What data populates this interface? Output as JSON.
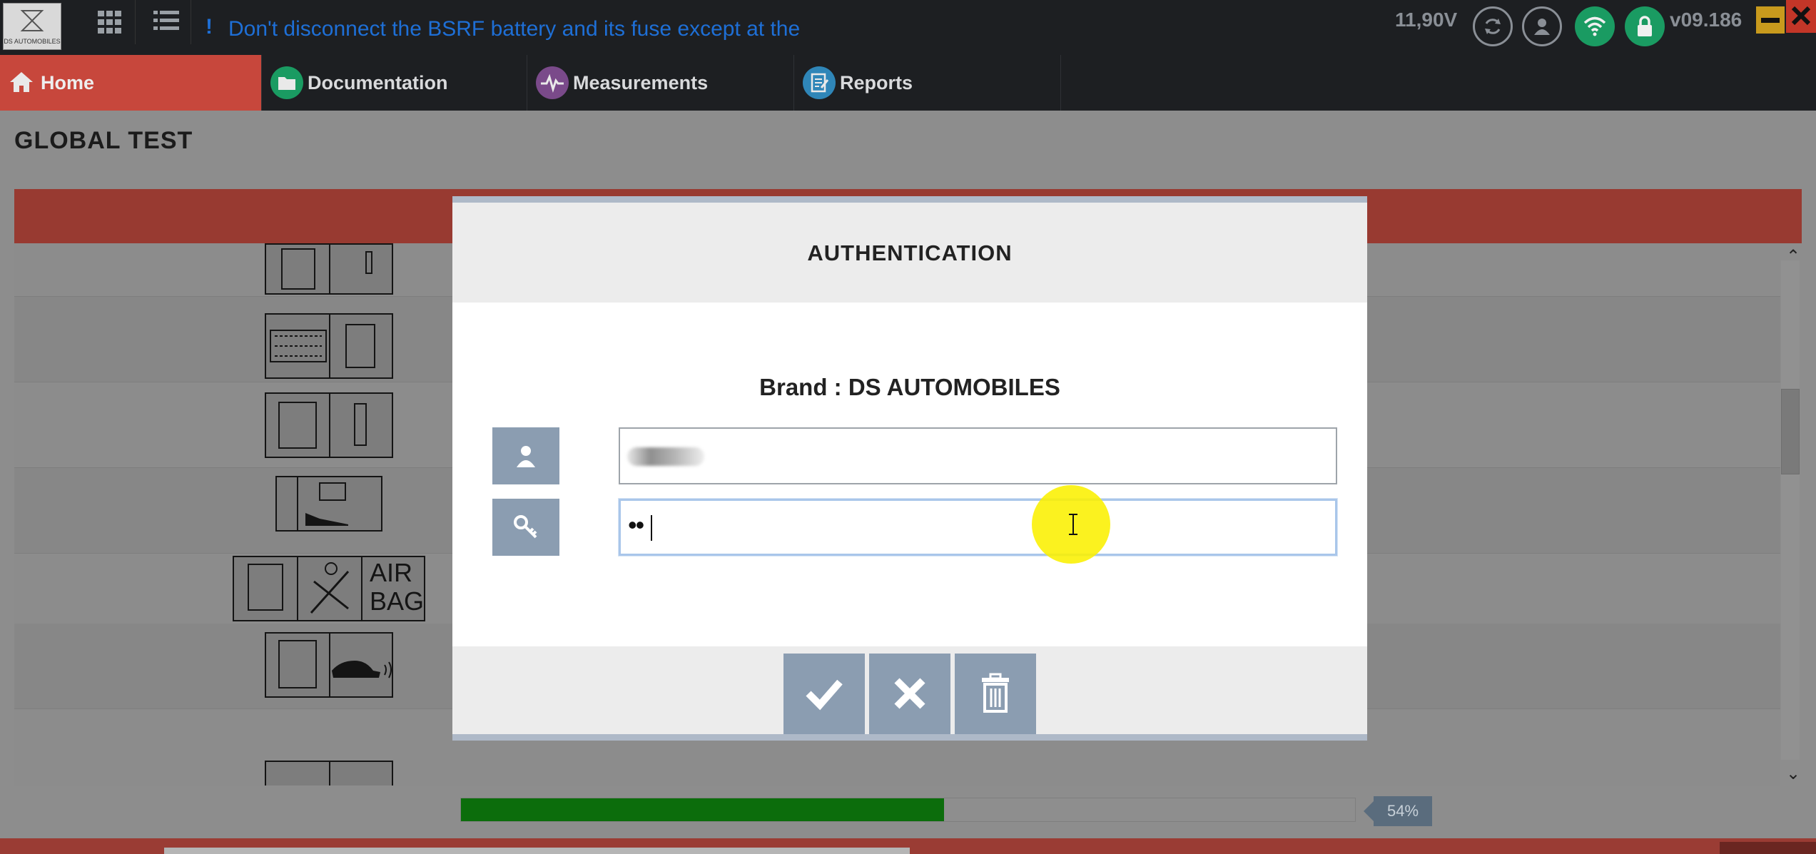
{
  "topbar": {
    "logo_text": "DS AUTOMOBILES",
    "warning_text": "Don't disconnect the BSRF battery and its fuse except at the",
    "voltage": "11,90V",
    "version": "v09.186",
    "icons": [
      "apps-grid-icon",
      "list-icon",
      "refresh-icon",
      "user-icon",
      "wifi-icon",
      "lock-icon",
      "minimize-icon",
      "close-icon"
    ],
    "colors": {
      "warning": "#1e6fd6",
      "wifi": "#1a9b62",
      "lock": "#1a9b62",
      "minimize": "#c89a1d",
      "close": "#c33628"
    }
  },
  "nav": {
    "tabs": [
      {
        "label": "Home",
        "icon": "home-icon",
        "active": true
      },
      {
        "label": "Documentation",
        "icon": "folder-icon"
      },
      {
        "label": "Measurements",
        "icon": "waveform-icon"
      },
      {
        "label": "Reports",
        "icon": "report-icon"
      }
    ]
  },
  "page": {
    "title": "GLOBAL TEST"
  },
  "ecu_list": {
    "items": [
      "ecu-relay-icon",
      "ecu-fusebox-icon",
      "ecu-fuse-icon",
      "battery-gauge-icon",
      "airbag-ecu-icon",
      "car-sensor-ecu-icon",
      "ecu-partial-icon"
    ],
    "airbag_text": [
      "AIR",
      "BAG"
    ]
  },
  "progress": {
    "value": 0.54,
    "label": "54%"
  },
  "modal": {
    "title": "AUTHENTICATION",
    "brand": "Brand : DS AUTOMOBILES",
    "password_value": "••",
    "buttons": [
      "confirm-button",
      "cancel-button",
      "delete-button"
    ]
  }
}
